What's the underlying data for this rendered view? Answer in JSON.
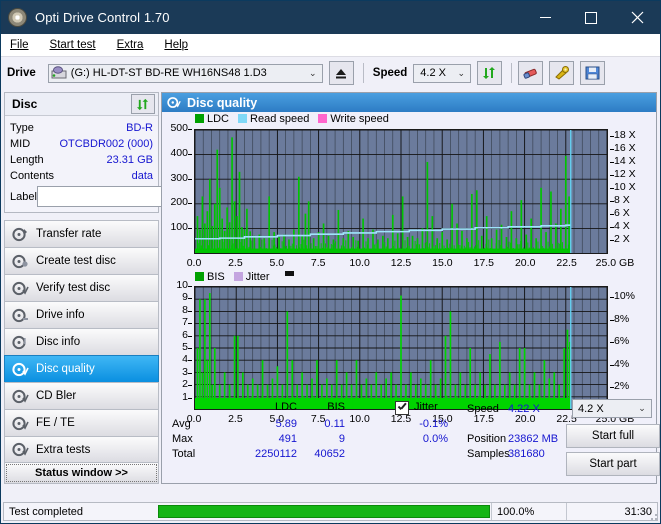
{
  "window": {
    "title": "Opti Drive Control 1.70",
    "minimize": "–",
    "maximize": "□",
    "close": "✕"
  },
  "menu": [
    {
      "label": "File"
    },
    {
      "label": "Start test"
    },
    {
      "label": "Extra"
    },
    {
      "label": "Help"
    }
  ],
  "toolbar": {
    "drive_label": "Drive",
    "drive_value": "(G:)  HL-DT-ST BD-RE  WH16NS48 1.D3",
    "eject_icon": "eject-icon",
    "speed_label": "Speed",
    "speed_value": "4.2 X",
    "refresh_icon": "refresh-icon",
    "erase_icon": "eraser-icon",
    "tools_icon": "tools-icon",
    "save_icon": "save-icon"
  },
  "disc": {
    "header": "Disc",
    "refresh_icon": "refresh-icon",
    "rows": [
      {
        "key": "Type",
        "value": "BD-R"
      },
      {
        "key": "MID",
        "value": "OTCBDR002 (000)"
      },
      {
        "key": "Length",
        "value": "23.31 GB"
      },
      {
        "key": "Contents",
        "value": "data"
      }
    ],
    "label_key": "Label",
    "label_value": "",
    "label_placeholder": "",
    "disc_icon": "disc-icon"
  },
  "sidebar": {
    "items": [
      {
        "label": "Transfer rate",
        "selected": false
      },
      {
        "label": "Create test disc",
        "selected": false
      },
      {
        "label": "Verify test disc",
        "selected": false
      },
      {
        "label": "Drive info",
        "selected": false
      },
      {
        "label": "Disc info",
        "selected": false
      },
      {
        "label": "Disc quality",
        "selected": true
      },
      {
        "label": "CD Bler",
        "selected": false
      },
      {
        "label": "FE / TE",
        "selected": false
      },
      {
        "label": "Extra tests",
        "selected": false
      }
    ],
    "status_window_button": "Status window >>"
  },
  "content": {
    "header": "Disc quality",
    "header_icon": "disc-quality-icon"
  },
  "chart_data": [
    {
      "type": "line",
      "title": "LDC / Read speed",
      "legend": [
        {
          "label": "LDC",
          "color": "#00a000"
        },
        {
          "label": "Read speed",
          "color": "#7fd8f7"
        },
        {
          "label": "Write speed",
          "color": "#ff66cc"
        }
      ],
      "legend_position": "top-left",
      "xlabel": "GB",
      "x_ticks": [
        "0.0",
        "2.5",
        "5.0",
        "7.5",
        "10.0",
        "12.5",
        "15.0",
        "17.5",
        "20.0",
        "22.5",
        "25.0 GB"
      ],
      "xlim": [
        0,
        25
      ],
      "ylabel": "LDC",
      "y_ticks": [
        "100",
        "200",
        "300",
        "400",
        "500"
      ],
      "ylim": [
        0,
        500
      ],
      "y2label": "Speed",
      "y2_ticks": [
        "2 X",
        "4 X",
        "6 X",
        "8 X",
        "10 X",
        "12 X",
        "14 X",
        "16 X",
        "18 X"
      ],
      "y2lim": [
        0,
        19
      ],
      "grid": true,
      "plot_bg": "#6b7b9c",
      "data_end_x": 22.8,
      "series": [
        {
          "name": "LDC",
          "color": "#00c400",
          "kind": "spikes",
          "baseline": 18,
          "spikes": [
            [
              0.15,
              150
            ],
            [
              0.3,
              95
            ],
            [
              0.45,
              230
            ],
            [
              0.6,
              120
            ],
            [
              0.75,
              170
            ],
            [
              0.9,
              300
            ],
            [
              1.05,
              110
            ],
            [
              1.2,
              200
            ],
            [
              1.35,
              420
            ],
            [
              1.5,
              265
            ],
            [
              1.65,
              140
            ],
            [
              1.8,
              90
            ],
            [
              1.95,
              185
            ],
            [
              2.1,
              125
            ],
            [
              2.25,
              470
            ],
            [
              2.4,
              210
            ],
            [
              2.55,
              150
            ],
            [
              2.7,
              330
            ],
            [
              2.85,
              105
            ],
            [
              3.0,
              95
            ],
            [
              3.15,
              180
            ],
            [
              3.35,
              88
            ],
            [
              3.6,
              70
            ],
            [
              3.9,
              75
            ],
            [
              4.2,
              60
            ],
            [
              4.5,
              230
            ],
            [
              4.8,
              85
            ],
            [
              5.1,
              65
            ],
            [
              5.4,
              75
            ],
            [
              5.7,
              55
            ],
            [
              6.0,
              95
            ],
            [
              6.3,
              310
            ],
            [
              6.5,
              70
            ],
            [
              6.7,
              160
            ],
            [
              6.9,
              210
            ],
            [
              7.2,
              60
            ],
            [
              7.5,
              85
            ],
            [
              7.8,
              120
            ],
            [
              8.1,
              70
            ],
            [
              8.4,
              55
            ],
            [
              8.7,
              175
            ],
            [
              9.0,
              60
            ],
            [
              9.3,
              90
            ],
            [
              9.6,
              65
            ],
            [
              9.9,
              50
            ],
            [
              10.2,
              140
            ],
            [
              10.5,
              60
            ],
            [
              10.8,
              95
            ],
            [
              11.1,
              55
            ],
            [
              11.4,
              70
            ],
            [
              11.7,
              60
            ],
            [
              12.0,
              155
            ],
            [
              12.3,
              80
            ],
            [
              12.6,
              230
            ],
            [
              12.9,
              65
            ],
            [
              13.2,
              70
            ],
            [
              13.5,
              60
            ],
            [
              13.8,
              100
            ],
            [
              14.1,
              370
            ],
            [
              14.4,
              150
            ],
            [
              14.7,
              60
            ],
            [
              15.0,
              85
            ],
            [
              15.3,
              55
            ],
            [
              15.6,
              200
            ],
            [
              15.9,
              120
            ],
            [
              16.2,
              90
            ],
            [
              16.5,
              60
            ],
            [
              16.8,
              240
            ],
            [
              17.1,
              255
            ],
            [
              17.4,
              70
            ],
            [
              17.7,
              150
            ],
            [
              18.0,
              60
            ],
            [
              18.3,
              95
            ],
            [
              18.6,
              115
            ],
            [
              18.9,
              65
            ],
            [
              19.2,
              170
            ],
            [
              19.5,
              60
            ],
            [
              19.8,
              215
            ],
            [
              20.1,
              75
            ],
            [
              20.4,
              140
            ],
            [
              20.7,
              60
            ],
            [
              21.0,
              265
            ],
            [
              21.3,
              85
            ],
            [
              21.6,
              250
            ],
            [
              21.9,
              120
            ],
            [
              22.2,
              180
            ],
            [
              22.5,
              395
            ],
            [
              22.7,
              230
            ]
          ]
        },
        {
          "name": "Read speed",
          "color": "#9fe4fb",
          "kind": "step",
          "points": [
            [
              0.0,
              2.2
            ],
            [
              1.5,
              2.3
            ],
            [
              3.0,
              2.5
            ],
            [
              5.0,
              2.7
            ],
            [
              7.0,
              2.9
            ],
            [
              9.0,
              3.1
            ],
            [
              11.0,
              3.3
            ],
            [
              13.0,
              3.5
            ],
            [
              15.0,
              3.7
            ],
            [
              17.0,
              3.9
            ],
            [
              19.0,
              4.05
            ],
            [
              21.0,
              4.2
            ],
            [
              22.5,
              4.3
            ],
            [
              22.8,
              4.3
            ]
          ]
        }
      ]
    },
    {
      "type": "line",
      "title": "BIS / Jitter",
      "legend": [
        {
          "label": "BIS",
          "color": "#00a000"
        },
        {
          "label": "Jitter",
          "color": "#c4a5e0"
        }
      ],
      "legend_position": "top-left",
      "xlabel": "GB",
      "x_ticks": [
        "0.0",
        "2.5",
        "5.0",
        "7.5",
        "10.0",
        "12.5",
        "15.0",
        "17.5",
        "20.0",
        "22.5",
        "25.0 GB"
      ],
      "xlim": [
        0,
        25
      ],
      "ylabel": "BIS",
      "y_ticks": [
        "1",
        "2",
        "3",
        "4",
        "5",
        "6",
        "7",
        "8",
        "9",
        "10"
      ],
      "ylim": [
        0,
        10
      ],
      "y2label": "Jitter",
      "y2_ticks": [
        "2%",
        "4%",
        "6%",
        "8%",
        "10%"
      ],
      "y2lim": [
        0,
        11
      ],
      "grid": true,
      "plot_bg": "#6b7b9c",
      "data_end_x": 22.8,
      "series": [
        {
          "name": "BIS",
          "color": "#00d400",
          "kind": "spikes",
          "baseline": 0.9,
          "spikes": [
            [
              0.15,
              5.0
            ],
            [
              0.3,
              9.0
            ],
            [
              0.45,
              3.0
            ],
            [
              0.6,
              9.0
            ],
            [
              0.75,
              4.0
            ],
            [
              0.9,
              9.5
            ],
            [
              1.05,
              2.0
            ],
            [
              1.2,
              5.0
            ],
            [
              1.5,
              2.0
            ],
            [
              1.8,
              3.0
            ],
            [
              2.1,
              2.0
            ],
            [
              2.4,
              6.0
            ],
            [
              2.6,
              6.0
            ],
            [
              2.9,
              3.0
            ],
            [
              3.2,
              2.0
            ],
            [
              3.5,
              2.5
            ],
            [
              3.8,
              2.0
            ],
            [
              4.1,
              4.0
            ],
            [
              4.4,
              2.0
            ],
            [
              4.7,
              2.5
            ],
            [
              5.0,
              3.5
            ],
            [
              5.3,
              2.0
            ],
            [
              5.6,
              8.0
            ],
            [
              5.9,
              4.0
            ],
            [
              6.2,
              2.0
            ],
            [
              6.5,
              3.0
            ],
            [
              6.8,
              2.0
            ],
            [
              7.1,
              2.5
            ],
            [
              7.4,
              4.0
            ],
            [
              7.7,
              2.0
            ],
            [
              8.0,
              2.5
            ],
            [
              8.3,
              2.0
            ],
            [
              8.6,
              4.0
            ],
            [
              8.9,
              2.0
            ],
            [
              9.2,
              3.0
            ],
            [
              9.5,
              2.0
            ],
            [
              9.8,
              4.0
            ],
            [
              10.1,
              2.0
            ],
            [
              10.4,
              2.5
            ],
            [
              10.7,
              2.0
            ],
            [
              11.0,
              3.0
            ],
            [
              11.3,
              2.0
            ],
            [
              11.6,
              2.5
            ],
            [
              11.9,
              3.0
            ],
            [
              12.2,
              2.0
            ],
            [
              12.5,
              9.3
            ],
            [
              12.8,
              2.0
            ],
            [
              13.1,
              3.0
            ],
            [
              13.4,
              2.0
            ],
            [
              13.7,
              2.5
            ],
            [
              14.0,
              2.0
            ],
            [
              14.3,
              4.0
            ],
            [
              14.6,
              2.0
            ],
            [
              14.9,
              2.5
            ],
            [
              15.2,
              6.0
            ],
            [
              15.5,
              8.0
            ],
            [
              15.8,
              2.0
            ],
            [
              16.1,
              3.0
            ],
            [
              16.4,
              2.0
            ],
            [
              16.7,
              5.0
            ],
            [
              17.0,
              2.0
            ],
            [
              17.3,
              3.0
            ],
            [
              17.6,
              2.0
            ],
            [
              17.9,
              4.5
            ],
            [
              18.2,
              2.0
            ],
            [
              18.5,
              5.5
            ],
            [
              18.8,
              2.0
            ],
            [
              19.1,
              3.0
            ],
            [
              19.4,
              2.0
            ],
            [
              19.7,
              5.0
            ],
            [
              20.0,
              5.0
            ],
            [
              20.3,
              2.0
            ],
            [
              20.6,
              3.0
            ],
            [
              20.9,
              2.0
            ],
            [
              21.2,
              4.0
            ],
            [
              21.5,
              2.5
            ],
            [
              21.8,
              3.0
            ],
            [
              22.1,
              2.0
            ],
            [
              22.4,
              5.0
            ],
            [
              22.6,
              6.5
            ],
            [
              22.75,
              5.5
            ]
          ]
        }
      ]
    }
  ],
  "stats": {
    "col_headers": [
      "LDC",
      "BIS"
    ],
    "jitter_label": "Jitter",
    "jitter_checked": true,
    "rows": [
      {
        "key": "Avg",
        "ldc": "5.89",
        "bis": "0.11",
        "jitter": "-0.1%"
      },
      {
        "key": "Max",
        "ldc": "491",
        "bis": "9",
        "jitter": "0.0%"
      },
      {
        "key": "Total",
        "ldc": "2250112",
        "bis": "40652",
        "jitter": ""
      }
    ],
    "speed_key": "Speed",
    "speed_value": "4.22 X",
    "position_key": "Position",
    "position_value": "23862 MB",
    "samples_key": "Samples",
    "samples_value": "381680",
    "speed_select": "4.2 X",
    "start_full_button": "Start full",
    "start_part_button": "Start part"
  },
  "footer": {
    "status_text": "Test completed",
    "progress_percent": "100.0%",
    "progress_value": 100,
    "elapsed_time": "31:30"
  }
}
